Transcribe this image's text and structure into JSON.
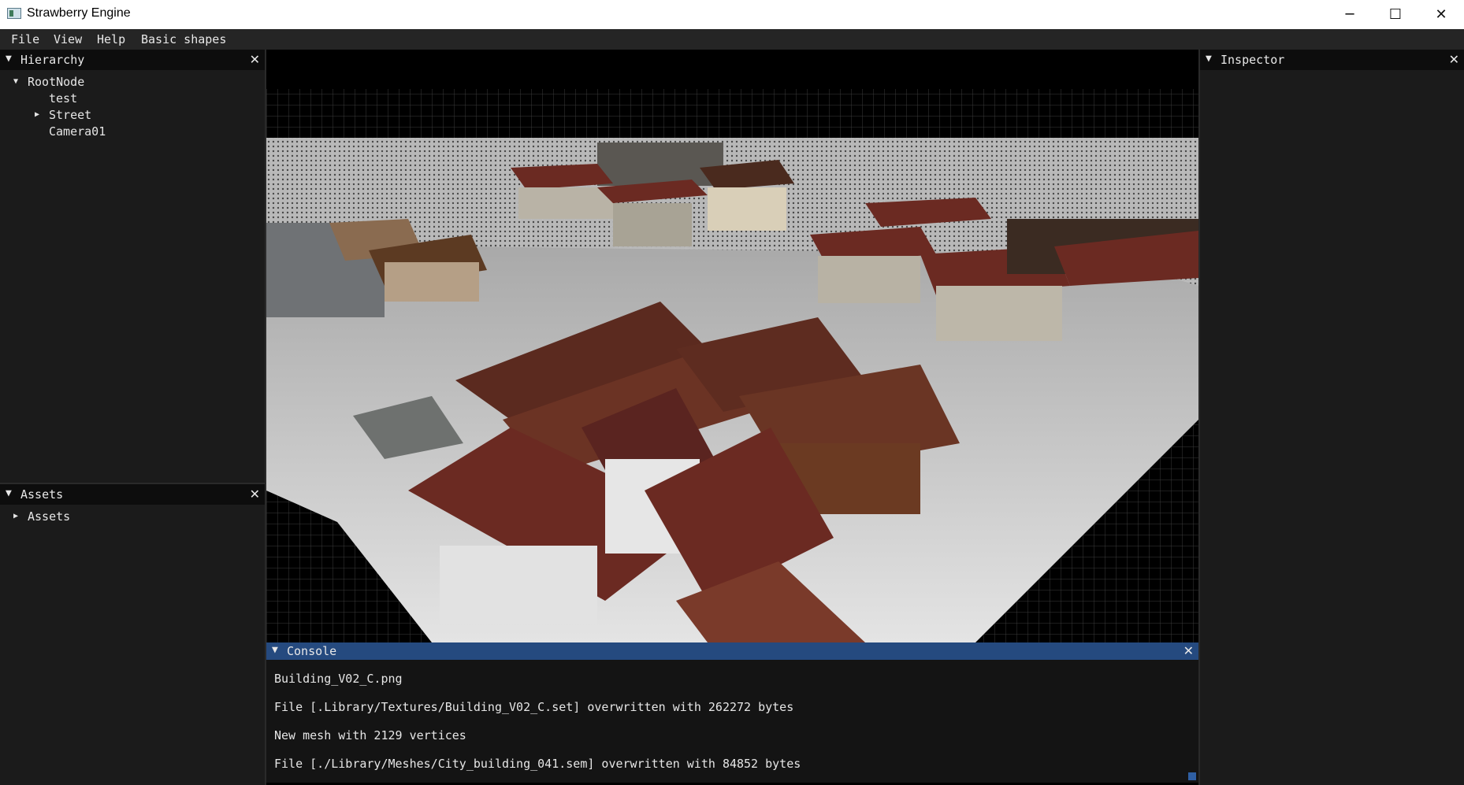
{
  "window": {
    "title": "Strawberry Engine",
    "minimize_glyph": "─",
    "maximize_glyph": "☐",
    "close_glyph": "✕"
  },
  "menu": [
    "File",
    "View",
    "Help",
    "Basic shapes"
  ],
  "hierarchy": {
    "title": "Hierarchy",
    "close": "✕",
    "nodes": [
      {
        "label": "RootNode",
        "arrow": "▼"
      },
      {
        "label": "test",
        "arrow": ""
      },
      {
        "label": "Street",
        "arrow": "▶"
      },
      {
        "label": "Camera01",
        "arrow": ""
      }
    ]
  },
  "assets": {
    "title": "Assets",
    "close": "✕",
    "nodes": [
      {
        "label": "Assets",
        "arrow": "▶"
      }
    ]
  },
  "inspector": {
    "title": "Inspector",
    "close": "✕"
  },
  "console": {
    "title": "Console",
    "close": "✕",
    "lines": [
      "Building_V02_C.png",
      "File [.Library/Textures/Building_V02_C.set] overwritten with 262272 bytes",
      "New mesh with 2129 vertices",
      "File [./Library/Meshes/City_building_041.sem] overwritten with 84852 bytes"
    ]
  },
  "colors": {
    "panel_bg": "#1b1b1b",
    "header_bg": "#0d0d0d",
    "console_header": "#254a7f",
    "roof": "#6b2a22",
    "ground": "#c9c9c9"
  }
}
